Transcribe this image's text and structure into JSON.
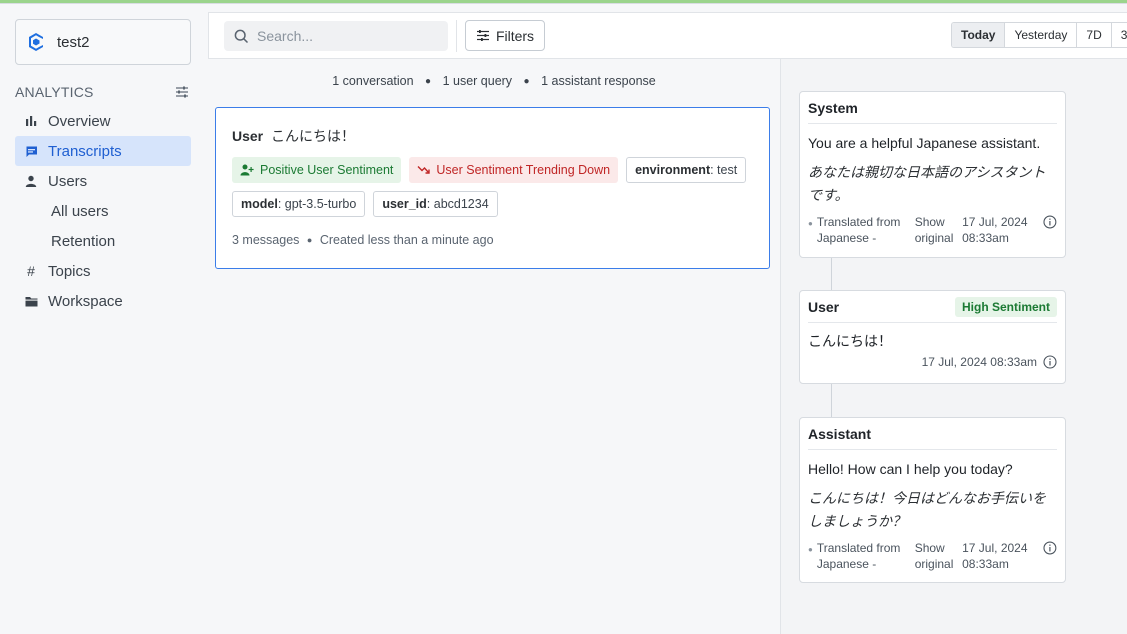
{
  "project": {
    "name": "test2"
  },
  "sidebar": {
    "section_title": "ANALYTICS",
    "items": [
      {
        "label": "Overview",
        "icon": "bar-chart-icon",
        "active": false
      },
      {
        "label": "Transcripts",
        "icon": "chat-icon",
        "active": true
      },
      {
        "label": "Users",
        "icon": "user-icon",
        "active": false
      },
      {
        "label": "All users",
        "sub": true
      },
      {
        "label": "Retention",
        "sub": true
      },
      {
        "label": "Topics",
        "icon": "hash-icon",
        "active": false
      },
      {
        "label": "Workspace",
        "icon": "folder-icon",
        "active": false
      }
    ]
  },
  "toolbar": {
    "search_placeholder": "Search...",
    "filters_label": "Filters",
    "ranges": [
      "Today",
      "Yesterday",
      "7D",
      "3"
    ],
    "active_range": "Today"
  },
  "stats": {
    "conversations": "1 conversation",
    "user_queries": "1 user query",
    "assistant_responses": "1 assistant response"
  },
  "conversation": {
    "role": "User",
    "title": "こんにちは！",
    "tags": {
      "positive": "Positive User Sentiment",
      "trending": "User Sentiment Trending Down",
      "env_key": "environment",
      "env_val": ": test",
      "model_key": "model",
      "model_val": ": gpt-3.5-turbo",
      "uid_key": "user_id",
      "uid_val": ": abcd1234"
    },
    "messages": "3 messages",
    "created": "Created less than a minute ago"
  },
  "messages": [
    {
      "role": "System",
      "text": "You are a helpful Japanese assistant.",
      "original": "あなたは親切な日本語のアシスタントです。",
      "translated_from": "Translated from Japanese -",
      "show_original": "Show original",
      "timestamp": "17 Jul, 2024 08:33am"
    },
    {
      "role": "User",
      "badge": "High Sentiment",
      "text": "こんにちは！",
      "timestamp": "17 Jul, 2024 08:33am"
    },
    {
      "role": "Assistant",
      "text": "Hello! How can I help you today?",
      "original": "こんにちは！今日はどんなお手伝いをしましょうか？",
      "translated_from": "Translated from Japanese -",
      "show_original": "Show original",
      "timestamp": "17 Jul, 2024 08:33am"
    }
  ],
  "colors": {
    "accent": "#1f5fd1",
    "active_bg": "#d6e4fb",
    "positive": "#1b7a33",
    "negative": "#c02626"
  }
}
